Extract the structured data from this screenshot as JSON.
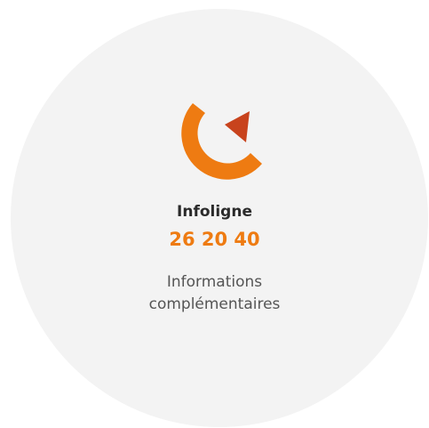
{
  "card": {
    "title": "Infoligne",
    "phone": "26 20 40",
    "info_line1": "Informations",
    "info_line2": "complémentaires"
  },
  "icons": {
    "logo": "compass-c-logo-icon"
  },
  "colors": {
    "accent": "#ee7b12",
    "triangle": "#c8431d",
    "background": "#f3f3f3",
    "title": "#2b2b2b",
    "text": "#555555"
  }
}
